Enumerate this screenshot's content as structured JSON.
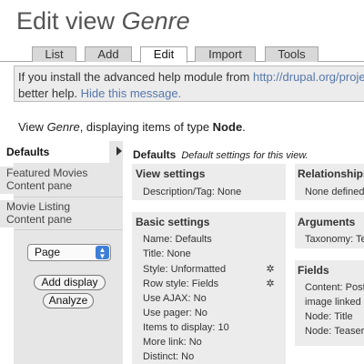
{
  "page": {
    "title_prefix": "Edit view",
    "title_name": "Genre"
  },
  "tabs": [
    {
      "label": "List"
    },
    {
      "label": "Add"
    },
    {
      "label": "Edit"
    },
    {
      "label": "Import"
    },
    {
      "label": "Tools"
    }
  ],
  "help": {
    "line1_text": "If you install the advanced help module from ",
    "line1_link": "http://drupal.org/proje",
    "line2_text": "better help. ",
    "line2_hide": "Hide this message."
  },
  "view_line": {
    "prefix": "View ",
    "name": "Genre",
    "middle": ", displaying items of type ",
    "type": "Node",
    "suffix": "."
  },
  "sidebar": {
    "items": [
      {
        "label": "Defaults"
      },
      {
        "label": "Featured Movies Content pane"
      },
      {
        "label": "Movie Listing Content pane"
      }
    ],
    "select_value": "Page",
    "add_display": "Add display",
    "analyze": "Analyze"
  },
  "main": {
    "heading": "Defaults",
    "heading_desc": "Default settings for this view.",
    "view_settings": {
      "title": "View settings",
      "description": "Description/Tag: None"
    },
    "basic_settings": {
      "title": "Basic settings",
      "rows": [
        "Name: Defaults",
        "Title: None",
        "Style: Unformatted",
        "Row style: Fields",
        "Use AJAX: No",
        "Use pager: No",
        "Items to display: 10",
        "More link: No",
        "Distinct: No"
      ]
    },
    "relationships": {
      "title": "Relationships",
      "value": "None defined"
    },
    "arguments": {
      "title": "Arguments",
      "value": "Taxonomy: Te"
    },
    "fields": {
      "title": "Fields",
      "rows": [
        "Content: Post",
        "image linked t",
        "Node: Title",
        "Node: Teaser"
      ]
    }
  },
  "icons": {
    "gear": "gear-icon",
    "caret": "select-caret-icon",
    "arrow": "active-arrow-icon"
  }
}
